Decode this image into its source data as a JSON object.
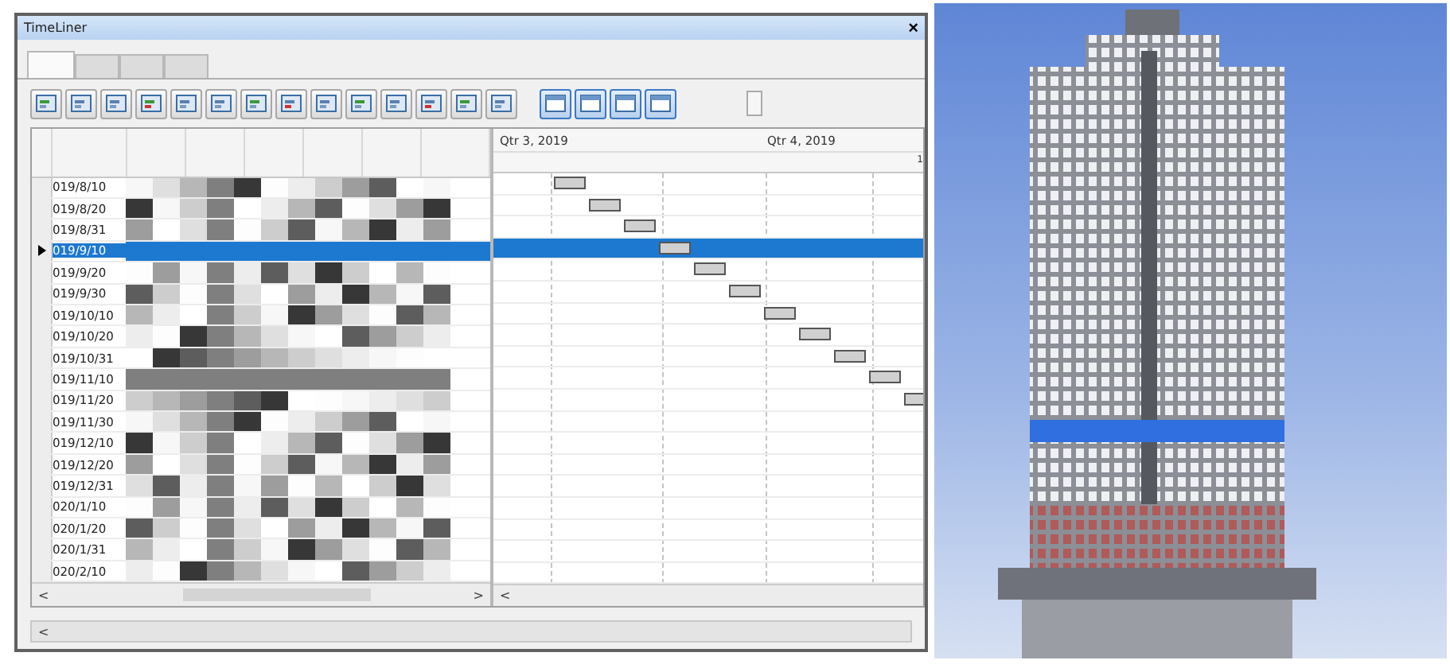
{
  "window": {
    "title": "TimeLiner",
    "close": "×"
  },
  "tabs": [
    {
      "selected": true
    },
    {
      "selected": false
    },
    {
      "selected": false
    },
    {
      "selected": false
    }
  ],
  "timeline": {
    "quarters": [
      "Qtr 3, 2019",
      "Qtr 4, 2019"
    ],
    "cut_label": "1"
  },
  "rows": [
    {
      "date": "019/8/10",
      "selected": false
    },
    {
      "date": "019/8/20",
      "selected": false
    },
    {
      "date": "019/8/31",
      "selected": false
    },
    {
      "date": "019/9/10",
      "selected": true
    },
    {
      "date": "019/9/20",
      "selected": false
    },
    {
      "date": "019/9/30",
      "selected": false
    },
    {
      "date": "019/10/10",
      "selected": false
    },
    {
      "date": "019/10/20",
      "selected": false
    },
    {
      "date": "019/10/31",
      "selected": false
    },
    {
      "date": "019/11/10",
      "selected": false
    },
    {
      "date": "019/11/20",
      "selected": false
    },
    {
      "date": "019/11/30",
      "selected": false
    },
    {
      "date": "019/12/10",
      "selected": false
    },
    {
      "date": "019/12/20",
      "selected": false
    },
    {
      "date": "019/12/31",
      "selected": false
    },
    {
      "date": "020/1/10",
      "selected": false
    },
    {
      "date": "020/1/20",
      "selected": false
    },
    {
      "date": "020/1/31",
      "selected": false
    },
    {
      "date": "020/2/10",
      "selected": false
    }
  ],
  "scroll": {
    "left": "<",
    "right": ">"
  }
}
